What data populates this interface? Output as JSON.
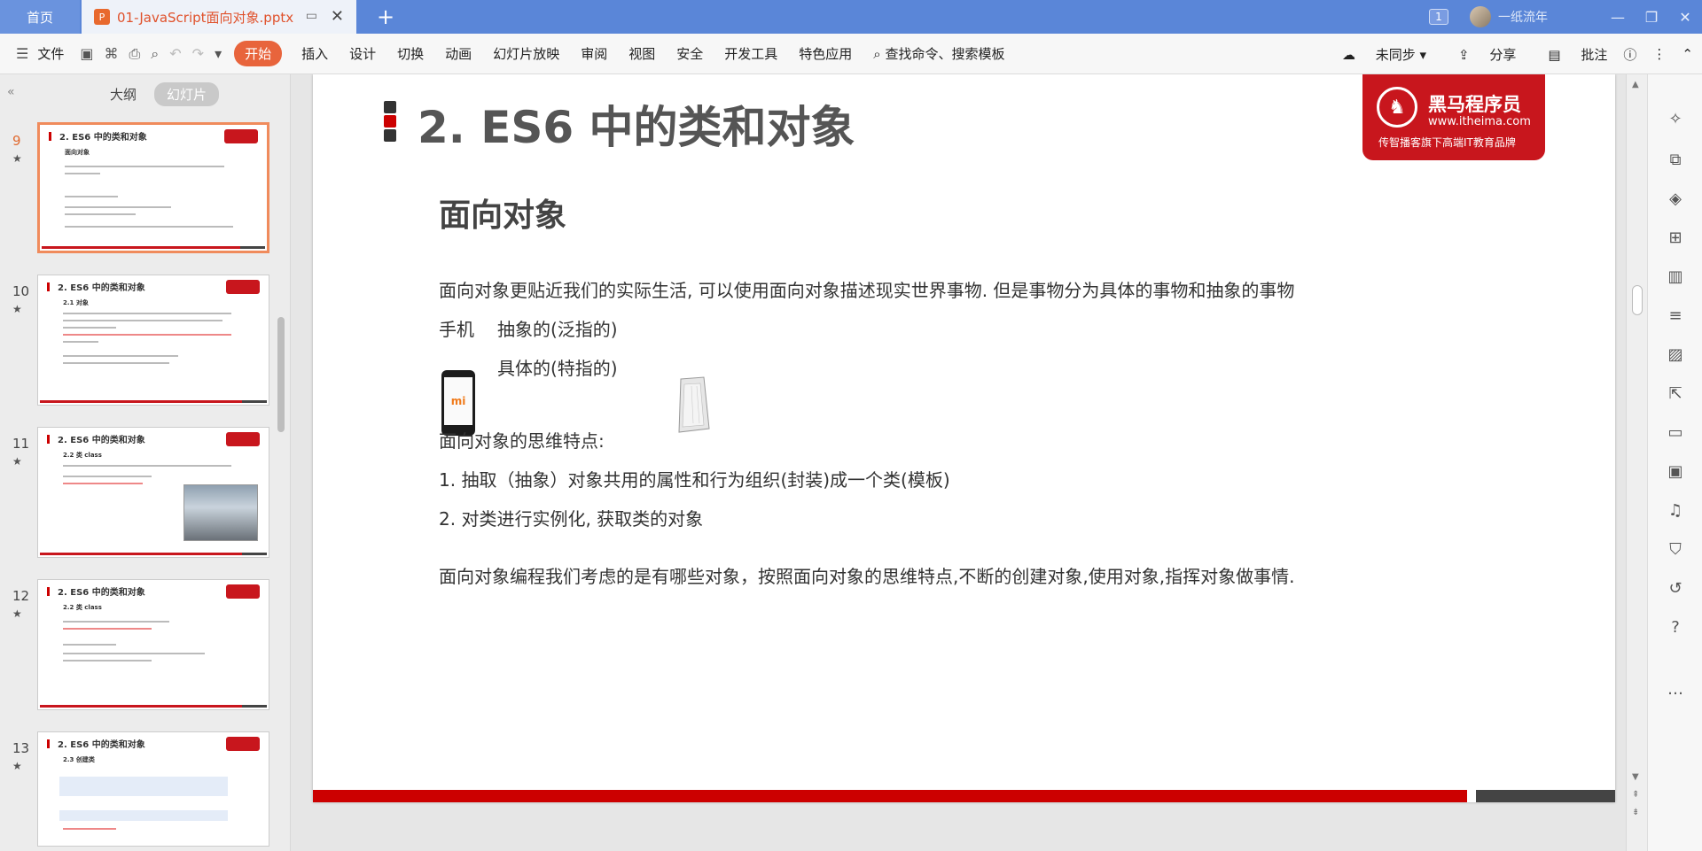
{
  "titlebar": {
    "home_tab": "首页",
    "doc_tab": "01-JavaScript面向对象.pptx",
    "doc_badge": "P",
    "page_count": "1",
    "username": "一纸流年"
  },
  "ribbon": {
    "file": "文件",
    "start": "开始",
    "tabs": [
      "插入",
      "设计",
      "切换",
      "动画",
      "幻灯片放映",
      "审阅",
      "视图",
      "安全",
      "开发工具",
      "特色应用"
    ],
    "search": "查找命令、搜索模板",
    "sync": "未同步",
    "share": "分享",
    "comment": "批注"
  },
  "leftpanel": {
    "tab_outline": "大纲",
    "tab_slides": "幻灯片",
    "thumbs": [
      {
        "num": "9",
        "title": "2. ES6 中的类和对象",
        "sub": "面向对象"
      },
      {
        "num": "10",
        "title": "2. ES6 中的类和对象",
        "sub": "2.1 对象"
      },
      {
        "num": "11",
        "title": "2. ES6 中的类和对象",
        "sub": "2.2 类 class"
      },
      {
        "num": "12",
        "title": "2. ES6 中的类和对象",
        "sub": "2.2 类 class"
      },
      {
        "num": "13",
        "title": "2. ES6 中的类和对象",
        "sub": "2.3 创建类"
      }
    ]
  },
  "slide": {
    "title": "2. ES6 中的类和对象",
    "logo": {
      "brand": "黑马程序员",
      "url": "www.itheima.com",
      "tagline": "传智播客旗下高端IT教育品牌"
    },
    "heading": "面向对象",
    "p1": "面向对象更贴近我们的实际生活, 可以使用面向对象描述现实世界事物.  但是事物分为具体的事物和抽象的事物",
    "phone_label": "手机",
    "abstract": "抽象的(泛指的)",
    "concrete": "具体的(特指的)",
    "phone_brand": "mi",
    "traits": "面向对象的思维特点:",
    "item1": "1.   抽取（抽象）对象共用的属性和行为组织(封装)成一个类(模板)",
    "item2": "2.   对类进行实例化, 获取类的对象",
    "summary": "面向对象编程我们考虑的是有哪些对象，按照面向对象的思维特点,不断的创建对象,使用对象,指挥对象做事情."
  },
  "colors": {
    "titlebar": "#5a86d8",
    "accent": "#e8643c",
    "brand_red": "#c8161d"
  }
}
